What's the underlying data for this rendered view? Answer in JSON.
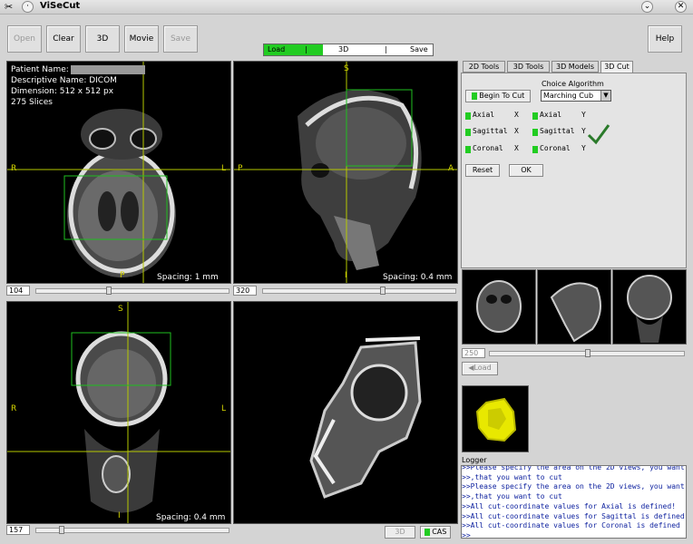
{
  "window": {
    "title": "ViSeCut"
  },
  "toolbar": {
    "open": "Open",
    "clear": "Clear",
    "three_d": "3D",
    "movie": "Movie",
    "save": "Save",
    "help": "Help"
  },
  "progress": {
    "load": "Load",
    "sep1": "|",
    "three_d": "3D",
    "sep2": "|",
    "save": "Save",
    "fill_fraction": 0.35
  },
  "axial_view": {
    "patient_name_label": "Patient Name:",
    "descriptive_name": "Descriptive Name: DICOM",
    "dimension": "Dimension: 512 x 512 px",
    "slices": "275 Slices",
    "label_right": "R",
    "label_left": "L",
    "label_posterior": "P",
    "spacing": "Spacing: 1 mm",
    "slice_value": "104"
  },
  "sagittal_view": {
    "label_superior": "S",
    "label_posterior": "P",
    "label_anterior": "A",
    "label_inferior": "I",
    "spacing": "Spacing: 0.4 mm",
    "slice_value": "320"
  },
  "coronal_view": {
    "label_superior": "S",
    "label_right": "R",
    "label_left": "L",
    "label_inferior": "I",
    "spacing": "Spacing: 0.4 mm",
    "slice_value": "157"
  },
  "bottom_right": {
    "three_d": "3D",
    "cas": "CAS"
  },
  "tabs": [
    "2D Tools",
    "3D Tools",
    "3D Models",
    "3D Cut"
  ],
  "cut_panel": {
    "begin_to_cut": "Begin To Cut",
    "choice_label": "Choice Algorithm",
    "choice_value": "Marching Cub",
    "rows": [
      {
        "left": "Axial",
        "lflag": "X",
        "right": "Axial",
        "rflag": "Y"
      },
      {
        "left": "Sagittal",
        "lflag": "X",
        "right": "Sagittal",
        "rflag": "Y"
      },
      {
        "left": "Coronal",
        "lflag": "X",
        "right": "Coronal",
        "rflag": "Y"
      }
    ],
    "reset": "Reset",
    "ok": "OK"
  },
  "thumbs": {
    "slider_value": "250",
    "load": "Load"
  },
  "logger": {
    "title": "Logger",
    "lines": [
      ">>Please specify the area on the 2D views, you want",
      ">>,that you want to cut",
      ">>Please specify the area on the 2D views, you want",
      ">>,that you want to cut",
      ">>All cut-coordinate values for Axial is defined!",
      ">>All cut-coordinate values for Sagittal is defined",
      ">>All cut-coordinate values for Coronal is defined",
      ">>"
    ]
  },
  "colors": {
    "accent_green": "#22cc22",
    "crosshair": "#b5c800",
    "roi": "#1fbf1f",
    "log_text": "#0b1f9e"
  }
}
